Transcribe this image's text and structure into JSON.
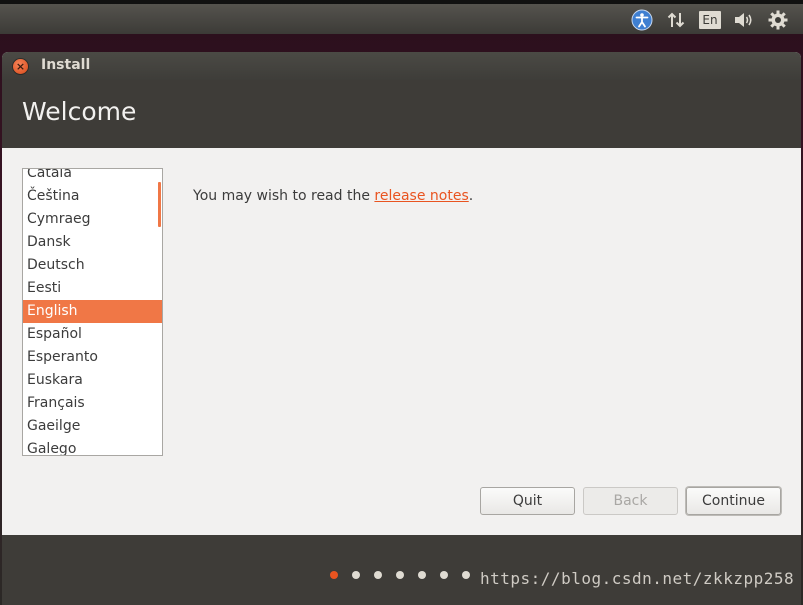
{
  "panel": {
    "accessibility_icon": "accessibility-icon",
    "network_icon": "network-updown-icon",
    "keyboard_layout": "En",
    "volume_icon": "volume-icon",
    "settings_icon": "gear-icon"
  },
  "window": {
    "title": "Install",
    "close_icon": "close-icon"
  },
  "header": {
    "title": "Welcome"
  },
  "languages": {
    "items": [
      "Català",
      "Čeština",
      "Cymraeg",
      "Dansk",
      "Deutsch",
      "Eesti",
      "English",
      "Español",
      "Esperanto",
      "Euskara",
      "Français",
      "Gaeilge",
      "Galego"
    ],
    "selected": "English"
  },
  "intro": {
    "prefix": "You may wish to read the ",
    "link": "release notes",
    "suffix": "."
  },
  "buttons": {
    "quit": "Quit",
    "back": "Back",
    "continue": "Continue"
  },
  "progress": {
    "total_steps": 7,
    "current_step": 1
  },
  "watermark": "https://blog.csdn.net/zkkzpp258",
  "colors": {
    "accent": "#e95420",
    "selection": "#f07746",
    "panel": "#3c3b37"
  }
}
